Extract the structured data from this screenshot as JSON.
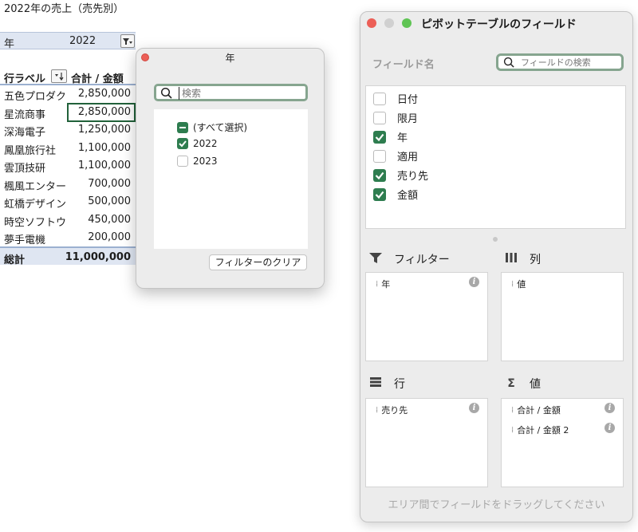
{
  "sheet": {
    "title": "2022年の売上（売先別）",
    "filter": {
      "label": "年",
      "value": "2022"
    },
    "header": {
      "row_label": "行ラベル",
      "value_label": "合計 / 金額"
    },
    "rows": [
      {
        "name": "五色プロダク",
        "amount": "2,850,000"
      },
      {
        "name": "星流商事",
        "amount": "2,850,000"
      },
      {
        "name": "深海電子",
        "amount": "1,250,000"
      },
      {
        "name": "鳳凰旅行社",
        "amount": "1,100,000"
      },
      {
        "name": "雲頂技研",
        "amount": "1,100,000"
      },
      {
        "name": "楓風エンター",
        "amount": "700,000"
      },
      {
        "name": "虹橋デザイン",
        "amount": "500,000"
      },
      {
        "name": "時空ソフトウ",
        "amount": "450,000"
      },
      {
        "name": "夢手電機",
        "amount": "200,000"
      }
    ],
    "total": {
      "label": "総計",
      "amount": "11,000,000"
    }
  },
  "filter_popup": {
    "title": "年",
    "search_placeholder": "検索",
    "items": [
      {
        "label": "(すべて選択)",
        "state": "mixed"
      },
      {
        "label": "2022",
        "state": "on"
      },
      {
        "label": "2023",
        "state": "off"
      }
    ],
    "clear_button": "フィルターのクリア"
  },
  "field_panel": {
    "title": "ピボットテーブルのフィールド",
    "field_name_label": "フィールド名",
    "search_placeholder": "フィールドの検索",
    "fields": [
      {
        "label": "日付",
        "checked": false
      },
      {
        "label": "限月",
        "checked": false
      },
      {
        "label": "年",
        "checked": true
      },
      {
        "label": "適用",
        "checked": false
      },
      {
        "label": "売り先",
        "checked": true
      },
      {
        "label": "金額",
        "checked": true
      }
    ],
    "areas": {
      "filters": {
        "label": "フィルター",
        "items": [
          "年"
        ]
      },
      "columns": {
        "label": "列",
        "items": [
          "値"
        ]
      },
      "rows": {
        "label": "行",
        "items": [
          "売り先"
        ]
      },
      "values": {
        "label": "値",
        "items": [
          "合計 / 金額",
          "合計 / 金額 2"
        ]
      }
    },
    "footer_hint": "エリア間でフィールドをドラッグしてください"
  },
  "colors": {
    "accent_green": "#2e7d4f",
    "header_blue": "#dfe6f2",
    "close_red": "#ec5f57"
  }
}
